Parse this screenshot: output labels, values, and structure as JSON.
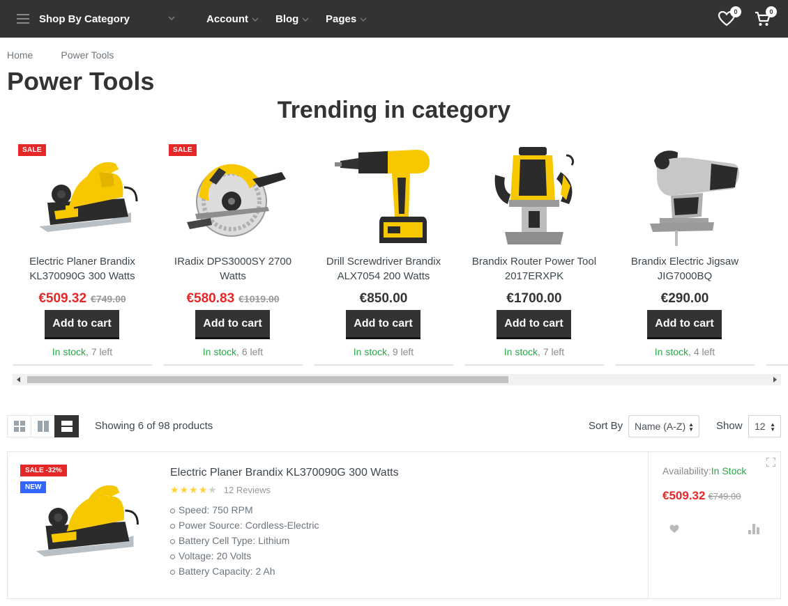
{
  "header": {
    "category_label": "Shop By Category",
    "nav": [
      "Account",
      "Blog",
      "Pages"
    ],
    "wishlist_count": "0",
    "cart_count": "0"
  },
  "breadcrumb": [
    "Home",
    "Power Tools"
  ],
  "page_title": "Power Tools",
  "section_title": "Trending in category",
  "trending": [
    {
      "sale_badge": "SALE",
      "name": "Electric Planer Brandix KL370090G 300 Watts",
      "price": "€509.32",
      "old_price": "€749.00",
      "button": "Add to cart",
      "stock_status": "In stock",
      "stock_left": ", 7 left"
    },
    {
      "sale_badge": "SALE",
      "name": "IRadix DPS3000SY 2700 Watts",
      "price": "€580.83",
      "old_price": "€1019.00",
      "button": "Add to cart",
      "stock_status": "In stock",
      "stock_left": ", 6 left"
    },
    {
      "sale_badge": "",
      "name": "Drill Screwdriver Brandix ALX7054 200 Watts",
      "price": "€850.00",
      "old_price": "",
      "button": "Add to cart",
      "stock_status": "In stock",
      "stock_left": ", 9 left"
    },
    {
      "sale_badge": "",
      "name": "Brandix Router Power Tool 2017ERXPK",
      "price": "€1700.00",
      "old_price": "",
      "button": "Add to cart",
      "stock_status": "In stock",
      "stock_left": ", 7 left"
    },
    {
      "sale_badge": "",
      "name": "Brandix Electric Jigsaw JIG7000BQ",
      "price": "€290.00",
      "old_price": "",
      "button": "Add to cart",
      "stock_status": "In stock",
      "stock_left": ", 4 left"
    }
  ],
  "carousel_scroll_fraction": 0.63,
  "toolbar": {
    "showing": "Showing 6 of 98 products",
    "sort_label": "Sort By",
    "sort_value": "Name (A-Z)",
    "show_label": "Show",
    "show_value": "12",
    "active_view": "list"
  },
  "product": {
    "sale_badge": "SALE -32%",
    "new_badge": "NEW",
    "name": "Electric Planer Brandix KL370090G 300 Watts",
    "rating": 4,
    "reviews": "12 Reviews",
    "features": [
      "Speed: 750 RPM",
      "Power Source: Cordless-Electric",
      "Battery Cell Type: Lithium",
      "Voltage: 20 Volts",
      "Battery Capacity: 2 Ah"
    ],
    "availability_label": "Availability:",
    "availability_value": "In Stock",
    "price": "€509.32",
    "old_price": "€749.00"
  },
  "colors": {
    "sale": "#e52727",
    "new_badge": "#3366ff",
    "in_stock": "#28a745",
    "star": "#ffd333",
    "dark": "#333333"
  }
}
